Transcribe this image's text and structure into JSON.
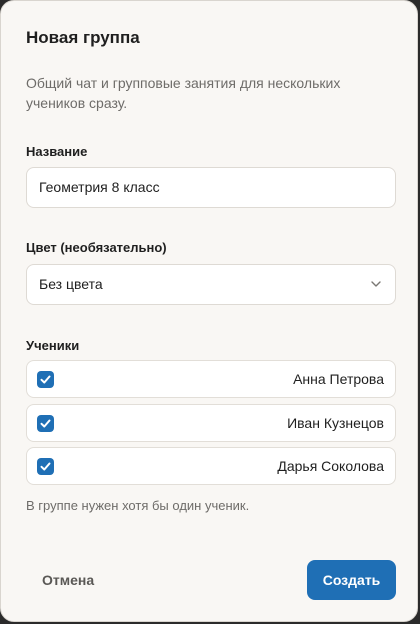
{
  "dialog": {
    "title": "Новая группа",
    "description": "Общий чат и групповые занятия для нескольких учеников сразу."
  },
  "name_field": {
    "label": "Название",
    "value": "Геометрия 8 класс"
  },
  "color_field": {
    "label": "Цвет (необязательно)",
    "selected": "Без цвета",
    "icon": "chevron-down-icon"
  },
  "students": {
    "label": "Ученики",
    "items": [
      {
        "name": "Анна Петрова",
        "checked": true
      },
      {
        "name": "Иван Кузнецов",
        "checked": true
      },
      {
        "name": "Дарья Соколова",
        "checked": true
      }
    ],
    "hint": "В группе нужен хотя бы один ученик."
  },
  "actions": {
    "cancel_label": "Отмена",
    "create_label": "Создать"
  },
  "colors": {
    "accent": "#1f6fb5",
    "background": "#f9f7f4"
  }
}
